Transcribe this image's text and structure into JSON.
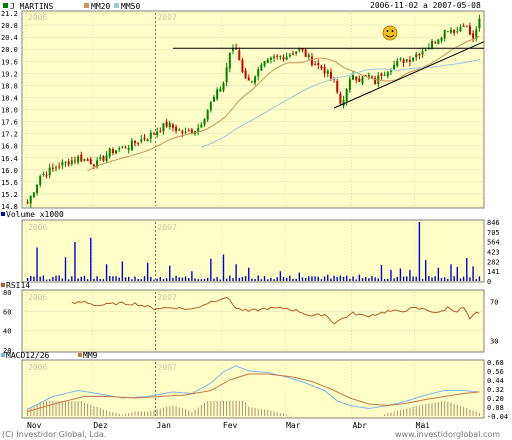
{
  "header": {
    "title": "J MARTINS",
    "ma20_label": "MM20",
    "ma50_label": "MM50",
    "date_range": "2006-11-02 a 2007-05-08"
  },
  "footer": {
    "left": "(C) Investidor Global, Lda.",
    "right": "www.investidorglobal.com"
  },
  "colors": {
    "panel_bg": "#ffffc8",
    "bull": "#008000",
    "bear": "#cc0000",
    "ma20": "#c8945a",
    "ma50": "#9cc8d8",
    "volume": "#0000cc",
    "rsi": "#b85c2c",
    "macd": "#7ab8e0",
    "signal": "#c8784a",
    "hist": "#b09070",
    "grid": "#cccccc"
  },
  "chart_data": [
    {
      "type": "candlestick",
      "title": "J MARTINS",
      "series": [
        {
          "name": "J MARTINS"
        },
        {
          "name": "MM20"
        },
        {
          "name": "MM50"
        }
      ],
      "y_ticks": [
        "21.2",
        "20.8",
        "20.4",
        "20.0",
        "19.6",
        "19.2",
        "18.8",
        "18.4",
        "18.0",
        "17.6",
        "17.2",
        "16.8",
        "16.4",
        "16.0",
        "15.6",
        "15.2",
        "14.8"
      ],
      "ylim": [
        14.8,
        21.2
      ],
      "x_labels": [
        "Nov",
        "Dez",
        "Jan",
        "Fev",
        "Mar",
        "Abr",
        "Mai"
      ],
      "year_marks": [
        "2006",
        "2007"
      ],
      "annotations": [
        "resistance line 20.05",
        "ascending trend line",
        "smiley icon"
      ],
      "close_waypoints": [
        [
          0,
          14.9
        ],
        [
          4,
          15.8
        ],
        [
          9,
          16.1
        ],
        [
          16,
          16.4
        ],
        [
          22,
          16.2
        ],
        [
          26,
          16.6
        ],
        [
          32,
          16.8
        ],
        [
          38,
          17.1
        ],
        [
          44,
          17.5
        ],
        [
          50,
          17.2
        ],
        [
          54,
          17.4
        ],
        [
          58,
          18.2
        ],
        [
          62,
          18.9
        ],
        [
          64,
          19.9
        ],
        [
          66,
          20.0
        ],
        [
          68,
          19.3
        ],
        [
          70,
          18.9
        ],
        [
          74,
          19.4
        ],
        [
          78,
          19.7
        ],
        [
          82,
          19.8
        ],
        [
          86,
          20.0
        ],
        [
          90,
          19.6
        ],
        [
          94,
          19.3
        ],
        [
          97,
          18.9
        ],
        [
          99,
          18.2
        ],
        [
          101,
          18.6
        ],
        [
          103,
          19.2
        ],
        [
          105,
          19.0
        ],
        [
          108,
          19.1
        ],
        [
          110,
          18.9
        ],
        [
          112,
          19.2
        ],
        [
          115,
          19.4
        ],
        [
          118,
          19.6
        ],
        [
          121,
          19.7
        ],
        [
          124,
          19.9
        ],
        [
          127,
          20.1
        ],
        [
          130,
          20.4
        ],
        [
          133,
          20.7
        ],
        [
          136,
          20.6
        ],
        [
          138,
          20.9
        ],
        [
          140,
          20.5
        ],
        [
          141,
          20.3
        ],
        [
          142,
          20.7
        ],
        [
          143,
          20.9
        ]
      ]
    },
    {
      "type": "bar",
      "title": "Volume x1000",
      "y_ticks": [
        "846",
        "705",
        "564",
        "423",
        "282",
        "141",
        "0"
      ],
      "ylim": [
        0,
        846
      ],
      "spikes": [
        [
          3,
          480
        ],
        [
          12,
          340
        ],
        [
          15,
          560
        ],
        [
          20,
          620
        ],
        [
          25,
          240
        ],
        [
          30,
          280
        ],
        [
          38,
          260
        ],
        [
          45,
          220
        ],
        [
          52,
          140
        ],
        [
          58,
          320
        ],
        [
          62,
          380
        ],
        [
          66,
          240
        ],
        [
          70,
          190
        ],
        [
          80,
          140
        ],
        [
          86,
          120
        ],
        [
          95,
          90
        ],
        [
          105,
          90
        ],
        [
          112,
          230
        ],
        [
          115,
          160
        ],
        [
          118,
          180
        ],
        [
          121,
          160
        ],
        [
          124,
          846
        ],
        [
          126,
          300
        ],
        [
          130,
          190
        ],
        [
          134,
          240
        ],
        [
          136,
          200
        ],
        [
          139,
          330
        ],
        [
          141,
          210
        ]
      ]
    },
    {
      "type": "line",
      "title": "RSI14",
      "y_ticks": [
        "80",
        "60",
        "40",
        "20"
      ],
      "right_ticks": [
        "70",
        "30"
      ],
      "ylim": [
        20,
        80
      ],
      "waypoints": [
        [
          14,
          68
        ],
        [
          18,
          70
        ],
        [
          22,
          66
        ],
        [
          28,
          68
        ],
        [
          34,
          68
        ],
        [
          40,
          63
        ],
        [
          46,
          64
        ],
        [
          52,
          62
        ],
        [
          58,
          70
        ],
        [
          62,
          74
        ],
        [
          64,
          72
        ],
        [
          66,
          63
        ],
        [
          70,
          60
        ],
        [
          76,
          63
        ],
        [
          82,
          63
        ],
        [
          86,
          60
        ],
        [
          90,
          55
        ],
        [
          94,
          57
        ],
        [
          97,
          48
        ],
        [
          100,
          53
        ],
        [
          103,
          58
        ],
        [
          107,
          55
        ],
        [
          110,
          57
        ],
        [
          114,
          60
        ],
        [
          118,
          60
        ],
        [
          122,
          63
        ],
        [
          126,
          62
        ],
        [
          130,
          58
        ],
        [
          133,
          64
        ],
        [
          136,
          60
        ],
        [
          138,
          64
        ],
        [
          140,
          52
        ],
        [
          142,
          58
        ],
        [
          143,
          57
        ]
      ]
    },
    {
      "type": "line",
      "title": "MACD12/26",
      "series": [
        {
          "name": "MACD12/26"
        },
        {
          "name": "MM9"
        }
      ],
      "y_ticks": [
        "0.68",
        "0.56",
        "0.44",
        "0.32",
        "0.20",
        "0.08",
        "-0.04"
      ],
      "ylim": [
        -0.04,
        0.68
      ],
      "macd_waypoints": [
        [
          0,
          0.05
        ],
        [
          8,
          0.22
        ],
        [
          16,
          0.3
        ],
        [
          22,
          0.26
        ],
        [
          30,
          0.2
        ],
        [
          38,
          0.22
        ],
        [
          46,
          0.28
        ],
        [
          52,
          0.26
        ],
        [
          58,
          0.4
        ],
        [
          62,
          0.55
        ],
        [
          66,
          0.63
        ],
        [
          70,
          0.56
        ],
        [
          76,
          0.54
        ],
        [
          82,
          0.48
        ],
        [
          88,
          0.4
        ],
        [
          94,
          0.3
        ],
        [
          98,
          0.16
        ],
        [
          102,
          0.1
        ],
        [
          108,
          0.06
        ],
        [
          114,
          0.1
        ],
        [
          120,
          0.16
        ],
        [
          126,
          0.24
        ],
        [
          132,
          0.3
        ],
        [
          138,
          0.3
        ],
        [
          143,
          0.28
        ]
      ],
      "signal_waypoints": [
        [
          0,
          0.02
        ],
        [
          10,
          0.14
        ],
        [
          18,
          0.22
        ],
        [
          26,
          0.22
        ],
        [
          34,
          0.2
        ],
        [
          42,
          0.22
        ],
        [
          50,
          0.24
        ],
        [
          58,
          0.3
        ],
        [
          64,
          0.44
        ],
        [
          70,
          0.52
        ],
        [
          76,
          0.52
        ],
        [
          84,
          0.48
        ],
        [
          90,
          0.42
        ],
        [
          96,
          0.32
        ],
        [
          102,
          0.2
        ],
        [
          108,
          0.12
        ],
        [
          114,
          0.1
        ],
        [
          120,
          0.13
        ],
        [
          126,
          0.18
        ],
        [
          132,
          0.22
        ],
        [
          138,
          0.26
        ],
        [
          143,
          0.28
        ]
      ]
    }
  ]
}
